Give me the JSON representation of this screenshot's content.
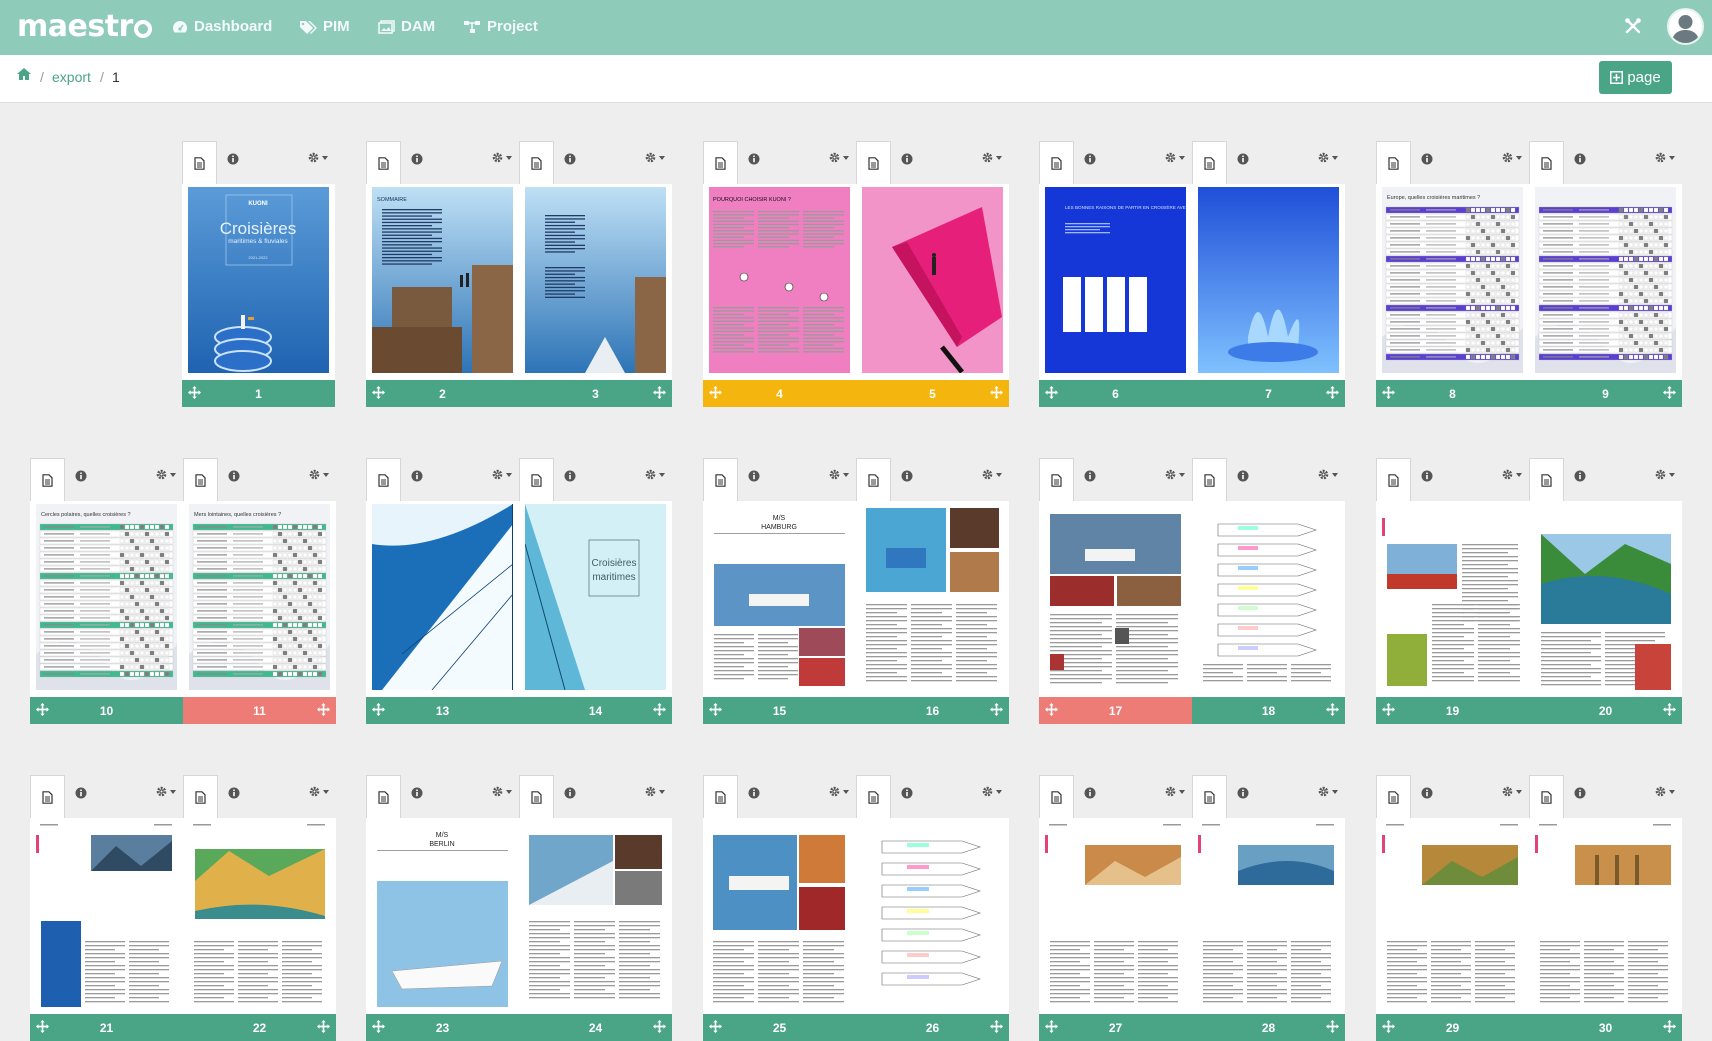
{
  "app": {
    "logo": "maestr"
  },
  "nav": [
    {
      "label": "Dashboard",
      "icon": "dashboard-icon"
    },
    {
      "label": "PIM",
      "icon": "tags-icon"
    },
    {
      "label": "DAM",
      "icon": "images-icon"
    },
    {
      "label": "Project",
      "icon": "sitemap-icon"
    }
  ],
  "breadcrumb": {
    "home_icon": "home-icon",
    "sep": "/",
    "export": "export",
    "current": "1"
  },
  "page_button": {
    "label": "page",
    "icon": "plus-square-icon"
  },
  "colors": {
    "header": "#8fcbb9",
    "accent": "#4aa586",
    "selected": "#f5b50f",
    "error": "#ed7b76"
  },
  "thumb_text": {
    "p1_brand": "KUONI",
    "p1_title": "Croisières",
    "p1_sub": "maritimes & fluviales",
    "p1_year": "2021-2022",
    "p2_title": "SOMMAIRE",
    "p4_title": "POURQUOI CHOISIR KUONI ?",
    "p6_title": "LES BONNES RAISONS DE PARTIR EN CROISIÈRE AVEC KUONI",
    "p8_title": "Europe, quelles croisières maritimes ?",
    "p10_title": "Cercles polaires, quelles croisières ?",
    "p11_title": "Mers lointaines, quelles croisières ?",
    "p14_title": "Croisières maritimes",
    "p15_title": "MS HAMBURG",
    "p23_title": "MS BERLIN"
  },
  "spreads": [
    {
      "pages": [
        {
          "num": "1",
          "state": "ok"
        }
      ]
    },
    {
      "pages": [
        {
          "num": "2",
          "state": "ok"
        },
        {
          "num": "3",
          "state": "ok"
        }
      ]
    },
    {
      "pages": [
        {
          "num": "4",
          "state": "selected"
        },
        {
          "num": "5",
          "state": "selected"
        }
      ]
    },
    {
      "pages": [
        {
          "num": "6",
          "state": "ok"
        },
        {
          "num": "7",
          "state": "ok"
        }
      ]
    },
    {
      "pages": [
        {
          "num": "8",
          "state": "ok"
        },
        {
          "num": "9",
          "state": "ok"
        }
      ]
    },
    {
      "pages": [
        {
          "num": "10",
          "state": "ok"
        },
        {
          "num": "11",
          "state": "error"
        }
      ]
    },
    {
      "pages": [
        {
          "num": "13",
          "state": "ok"
        },
        {
          "num": "14",
          "state": "ok"
        }
      ]
    },
    {
      "pages": [
        {
          "num": "15",
          "state": "ok"
        },
        {
          "num": "16",
          "state": "ok"
        }
      ]
    },
    {
      "pages": [
        {
          "num": "17",
          "state": "error"
        },
        {
          "num": "18",
          "state": "ok"
        }
      ]
    },
    {
      "pages": [
        {
          "num": "19",
          "state": "ok"
        },
        {
          "num": "20",
          "state": "ok"
        }
      ]
    },
    {
      "pages": [
        {
          "num": "21",
          "state": "ok"
        },
        {
          "num": "22",
          "state": "ok"
        }
      ]
    },
    {
      "pages": [
        {
          "num": "23",
          "state": "ok"
        },
        {
          "num": "24",
          "state": "ok"
        }
      ]
    },
    {
      "pages": [
        {
          "num": "25",
          "state": "ok"
        },
        {
          "num": "26",
          "state": "ok"
        }
      ]
    },
    {
      "pages": [
        {
          "num": "27",
          "state": "ok"
        },
        {
          "num": "28",
          "state": "ok"
        }
      ]
    },
    {
      "pages": [
        {
          "num": "29",
          "state": "ok"
        },
        {
          "num": "30",
          "state": "ok"
        }
      ]
    }
  ]
}
